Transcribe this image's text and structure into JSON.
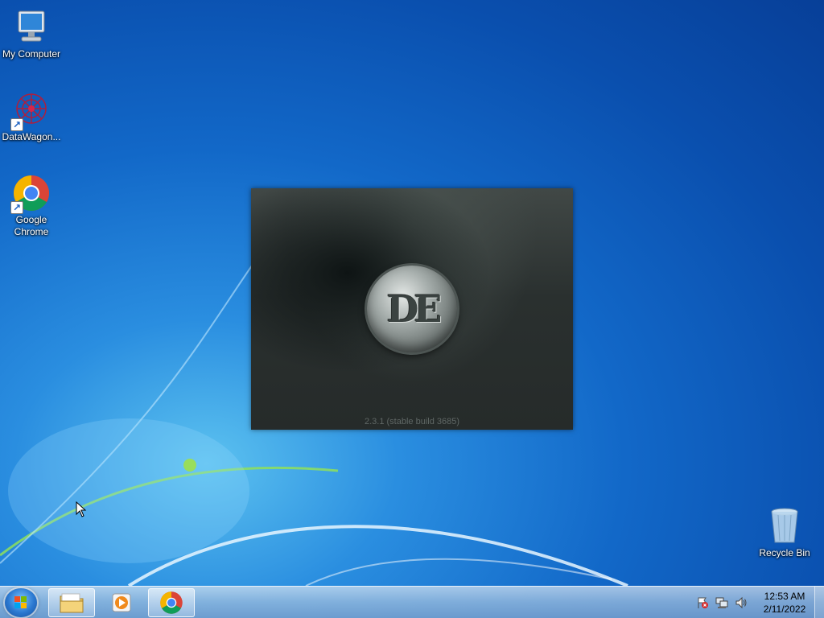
{
  "desktop": {
    "icons": [
      {
        "label": "My Computer",
        "icon": "computer-icon"
      },
      {
        "label": "DataWagon...",
        "icon": "datawagon-icon"
      },
      {
        "label": "Google Chrome",
        "icon": "chrome-icon"
      },
      {
        "label": "Recycle Bin",
        "icon": "recycle-bin-icon"
      }
    ]
  },
  "splash": {
    "logo_text": "DE",
    "version": "2.3.1 (stable build 3685)"
  },
  "taskbar": {
    "start_icon": "windows-start-icon",
    "items": [
      {
        "name": "File Explorer",
        "icon": "folder-icon"
      },
      {
        "name": "Media Player",
        "icon": "media-player-icon"
      },
      {
        "name": "Google Chrome",
        "icon": "chrome-icon"
      }
    ],
    "tray": {
      "icons": [
        "action-center-flag-icon",
        "network-icon",
        "volume-icon"
      ],
      "time": "12:53 AM",
      "date": "2/11/2022"
    }
  },
  "colors": {
    "desktop_blue": "#1268c8",
    "splash_bg": "#2f3534",
    "taskbar": "#a6c3e3"
  }
}
